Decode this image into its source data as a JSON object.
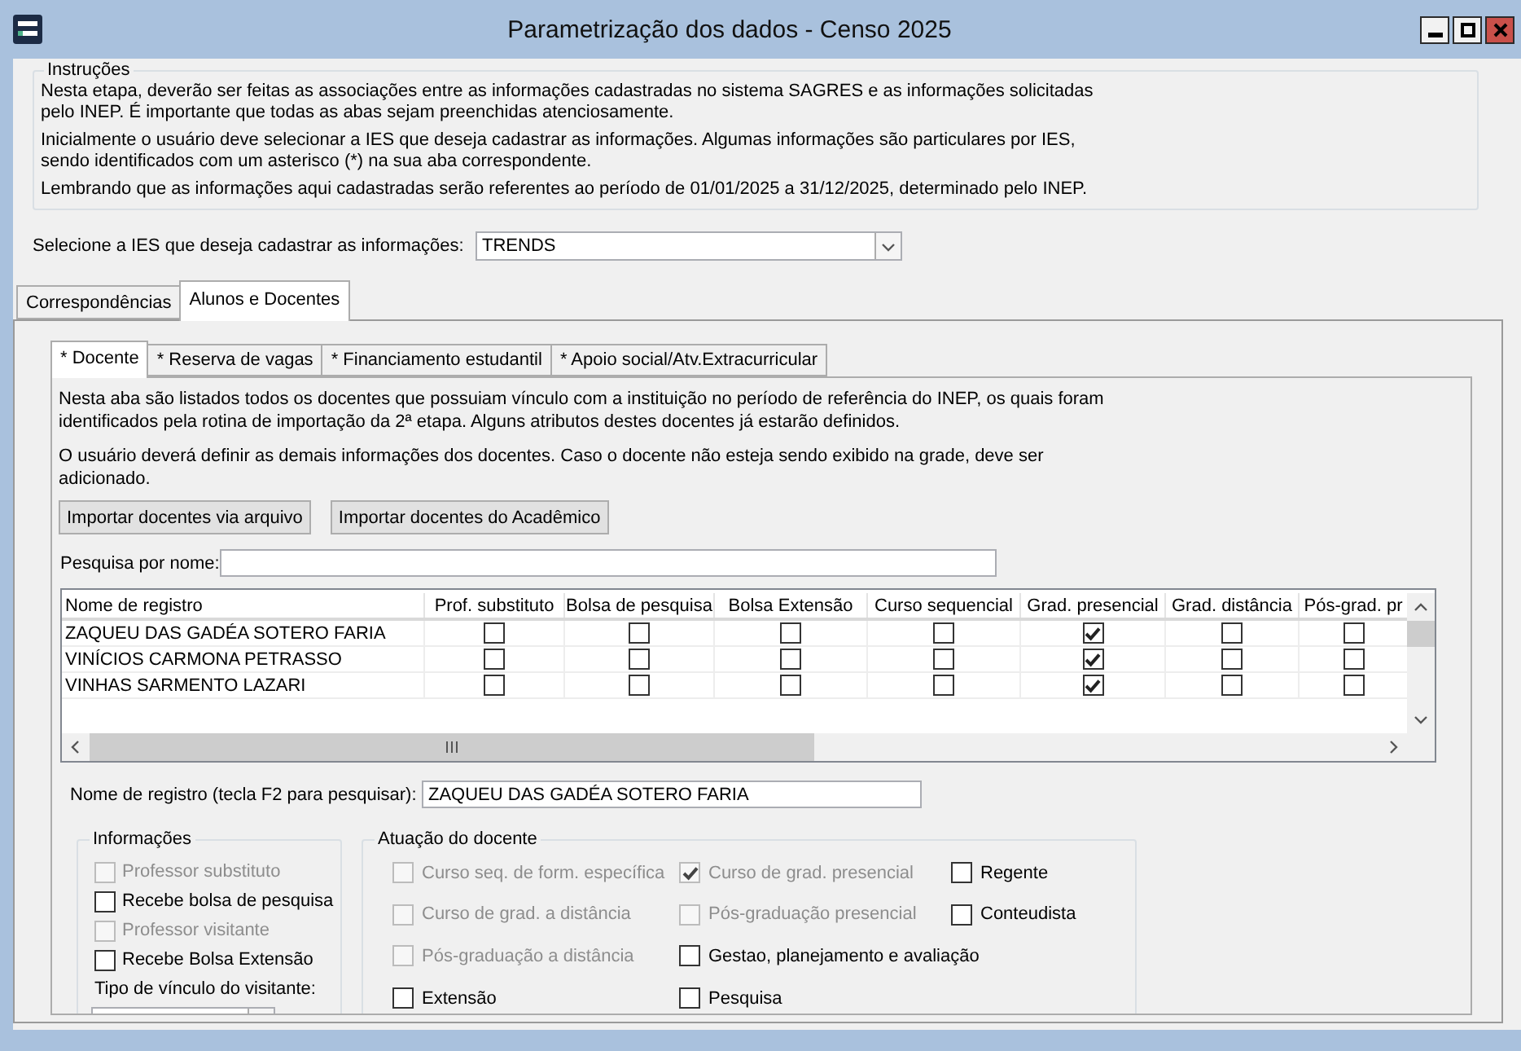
{
  "window": {
    "title": "Parametrização dos dados - Censo 2025"
  },
  "instructions": {
    "title": "Instruções",
    "paragraphs": [
      "Nesta etapa, deverão ser feitas as associações entre as informações cadastradas no sistema SAGRES e as informações solicitadas\npelo INEP. É importante que todas as abas sejam preenchidas atenciosamente.",
      "Inicialmente o usuário deve selecionar a IES que deseja cadastrar as informações. Algumas informações são particulares por IES,\nsendo identificados com um asterisco (*) na sua aba correspondente.",
      "Lembrando que as informações aqui cadastradas serão referentes ao período de 01/01/2025 a 31/12/2025, determinado pelo INEP."
    ]
  },
  "ies_select": {
    "label": "Selecione a IES que deseja cadastrar as informações:",
    "value": "TRENDS"
  },
  "tabs": [
    {
      "label": "Correspondências",
      "selected": false
    },
    {
      "label": "Alunos e Docentes",
      "selected": true
    }
  ],
  "subtabs": [
    {
      "label": "* Docente",
      "selected": true
    },
    {
      "label": "* Reserva de vagas",
      "selected": false
    },
    {
      "label": "* Financiamento estudantil",
      "selected": false
    },
    {
      "label": "* Apoio social/Atv.Extracurricular",
      "selected": false
    }
  ],
  "description": [
    "Nesta aba são listados todos os docentes que possuiam vínculo com a instituição no período de referência do INEP, os quais foram\nidentificados pela rotina de importação da 2ª etapa. Alguns atributos destes docentes já estarão definidos.",
    "O usuário deverá definir as demais informações dos docentes. Caso o docente não esteja sendo exibido na grade, deve ser\nadicionado."
  ],
  "buttons": [
    "Importar docentes via arquivo",
    "Importar docentes do Acadêmico"
  ],
  "name_search": {
    "label": "Pesquisa por nome:"
  },
  "grid": {
    "columns": [
      "Nome de registro",
      "Prof. substituto",
      "Bolsa de pesquisa",
      "Bolsa Extensão",
      "Curso sequencial",
      "Grad. presencial",
      "Grad. distância",
      "Pós-grad. pr"
    ],
    "rows": [
      {
        "name": "ZAQUEU DAS GADÉA SOTERO FARIA",
        "checks": [
          false,
          false,
          false,
          false,
          true,
          false,
          false
        ]
      },
      {
        "name": "VINÍCIOS CARMONA PETRASSO",
        "checks": [
          false,
          false,
          false,
          false,
          true,
          false,
          false
        ]
      },
      {
        "name": "VINHAS SARMENTO LAZARI",
        "checks": [
          false,
          false,
          false,
          false,
          true,
          false,
          false
        ]
      }
    ]
  },
  "registry": {
    "label": "Nome de registro (tecla F2 para pesquisar):",
    "value": "ZAQUEU DAS GADÉA SOTERO FARIA"
  },
  "informacoes": {
    "title": "Informações",
    "items": [
      {
        "label": "Professor substituto",
        "checked": false,
        "disabled": true
      },
      {
        "label": "Recebe bolsa de pesquisa",
        "checked": false,
        "disabled": false
      },
      {
        "label": "Professor visitante",
        "checked": false,
        "disabled": true
      },
      {
        "label": "Recebe Bolsa Extensão",
        "checked": false,
        "disabled": false
      }
    ],
    "visitor_type": {
      "label": "Tipo de vínculo do visitante:"
    }
  },
  "atuacao": {
    "title": "Atuação do docente",
    "columns": [
      [
        {
          "label": "Curso seq. de form. específica",
          "checked": false,
          "disabled": true
        },
        {
          "label": "Curso de grad. a distância",
          "checked": false,
          "disabled": true
        },
        {
          "label": "Pós-graduação a distância",
          "checked": false,
          "disabled": true
        },
        {
          "label": "Extensão",
          "checked": false,
          "disabled": false
        }
      ],
      [
        {
          "label": "Curso de grad. presencial",
          "checked": true,
          "disabled": true
        },
        {
          "label": "Pós-graduação presencial",
          "checked": false,
          "disabled": true
        },
        {
          "label": "Gestao, planejamento e avaliação",
          "checked": false,
          "disabled": false
        },
        {
          "label": "Pesquisa",
          "checked": false,
          "disabled": false
        }
      ],
      [
        {
          "label": "Regente",
          "checked": false,
          "disabled": false
        },
        {
          "label": "Conteudista",
          "checked": false,
          "disabled": false
        }
      ]
    ]
  }
}
